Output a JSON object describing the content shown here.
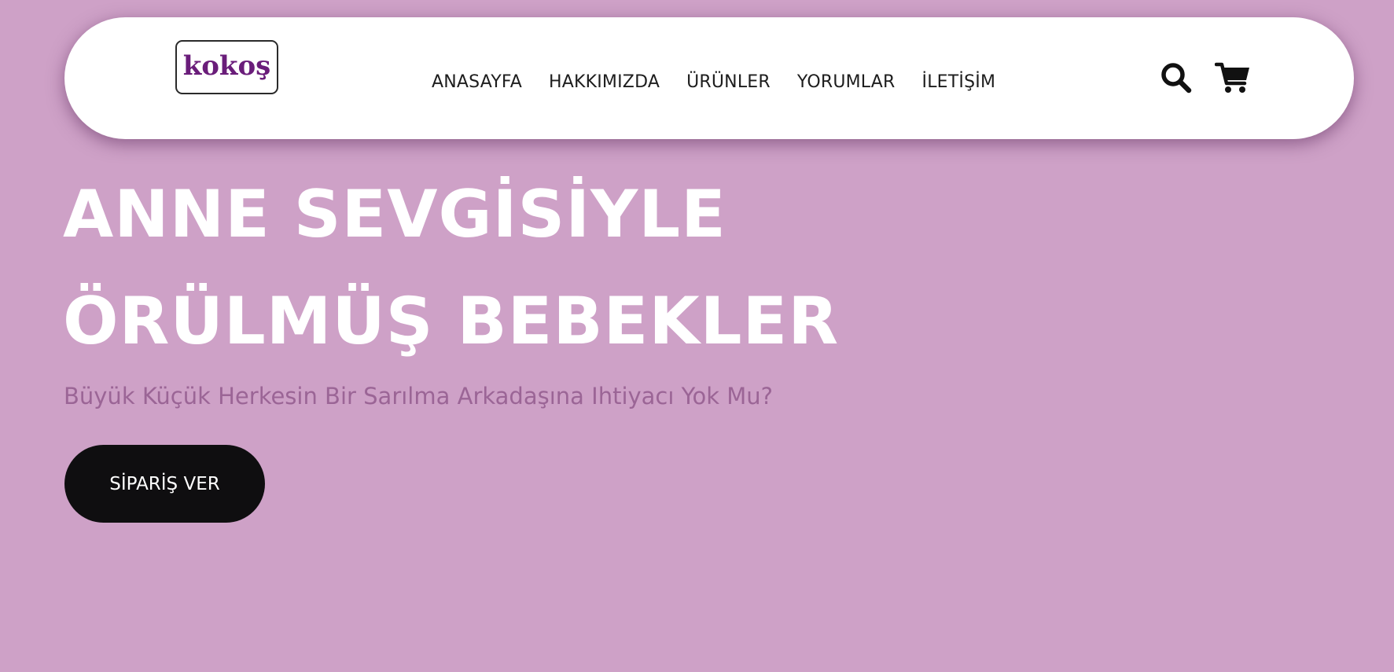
{
  "colors": {
    "background": "#cea1c7",
    "navbar": "#ffffff",
    "logo_text": "#6a1d7a",
    "hero_title": "#ffffff",
    "hero_subtitle": "#9b6596",
    "cta_background": "#0f0e10",
    "cta_text": "#ffffff",
    "icon": "#111111"
  },
  "header": {
    "logo_text": "kokoş",
    "nav_links": [
      {
        "label": "ANASAYFA"
      },
      {
        "label": "HAKKIMIZDA"
      },
      {
        "label": "ÜRÜNLER"
      },
      {
        "label": "YORUMLAR"
      },
      {
        "label": "İLETİŞİM"
      }
    ],
    "icons": {
      "search": "search-icon",
      "cart": "cart-icon"
    }
  },
  "hero": {
    "title_line_1": "ANNE SEVGİSİYLE",
    "title_line_2": "ÖRÜLMÜŞ BEBEKLER",
    "subtitle": "Büyük Küçük Herkesin Bir Sarılma Arkadaşına Ihtiyacı Yok Mu?",
    "cta_label": "SİPARİŞ VER"
  }
}
